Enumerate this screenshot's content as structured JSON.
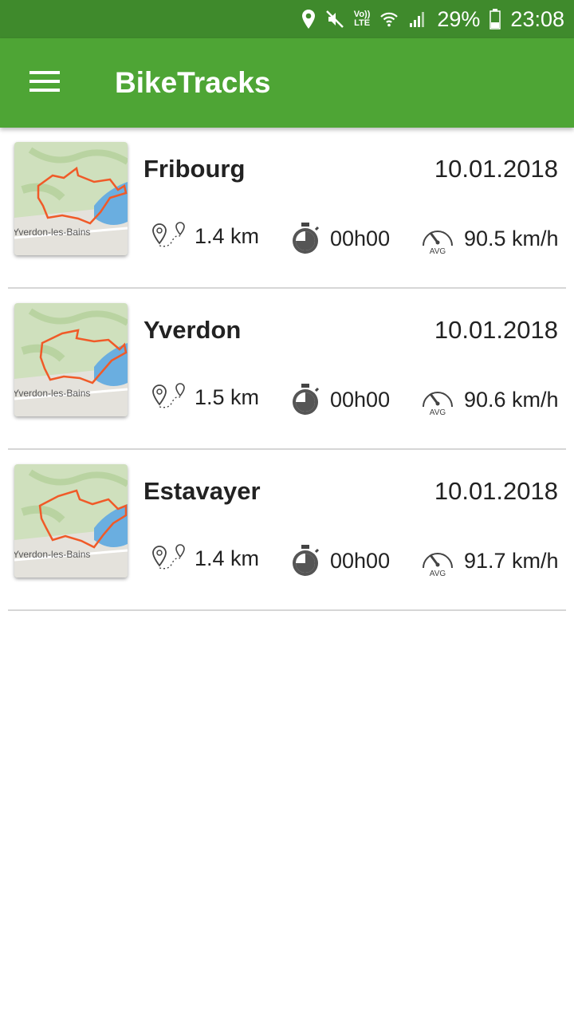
{
  "status_bar": {
    "network_label": "LTE",
    "voice_label": "Vo))",
    "battery": "29%",
    "time": "23:08"
  },
  "app_bar": {
    "title": "BikeTracks",
    "menu_icon": "hamburger-menu-icon"
  },
  "tracks": [
    {
      "name": "Fribourg",
      "date": "10.01.2018",
      "distance": "1.4 km",
      "duration": "00h00",
      "avg_speed": "90.5 km/h",
      "map_label": "Yverdon-les-Bains"
    },
    {
      "name": "Yverdon",
      "date": "10.01.2018",
      "distance": "1.5 km",
      "duration": "00h00",
      "avg_speed": "90.6 km/h",
      "map_label": "Yverdon-les-Bains"
    },
    {
      "name": "Estavayer",
      "date": "10.01.2018",
      "distance": "1.4 km",
      "duration": "00h00",
      "avg_speed": "91.7 km/h",
      "map_label": "Yverdon-les-Bains"
    }
  ],
  "icons": {
    "distance": "route-pins-icon",
    "duration": "stopwatch-icon",
    "speed": "speedometer-avg-icon"
  },
  "speed_icon_label": "AVG",
  "colors": {
    "status_bar": "#3f8a2c",
    "app_bar": "#4ea535",
    "route_line": "#f05a28",
    "map_water": "#6aaee0",
    "divider": "#d6d6d6"
  }
}
